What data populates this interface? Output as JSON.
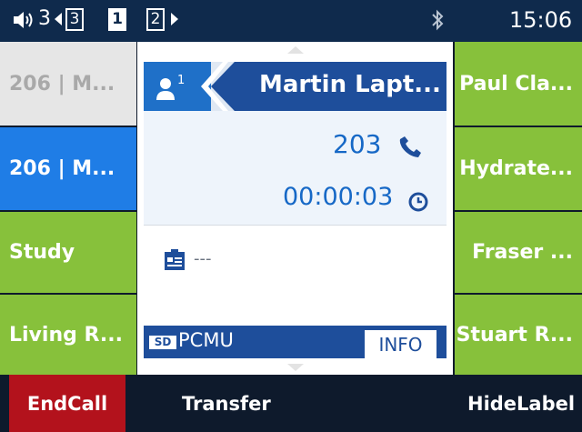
{
  "status_bar": {
    "line_number": "3",
    "pages": [
      "3",
      "1",
      "2"
    ],
    "active_page": "1",
    "time": "15:06"
  },
  "left_keys": [
    {
      "label": "206 | M..."
    },
    {
      "label": "206 | M..."
    },
    {
      "label": "Study"
    },
    {
      "label": "Living R..."
    }
  ],
  "right_keys": [
    {
      "label": "Paul Cla..."
    },
    {
      "label": "Hydrate..."
    },
    {
      "label": "Fraser ..."
    },
    {
      "label": "Stuart R..."
    }
  ],
  "call": {
    "contact_badge": "1",
    "name": "Martin Lapt...",
    "extension": "203",
    "duration": "00:00:03",
    "card_text": "---",
    "codec_badge": "SD",
    "codec": "PCMU",
    "info_label": "INFO"
  },
  "softkeys": {
    "end_call": "EndCall",
    "transfer": "Transfer",
    "hide_label": "HideLabel"
  },
  "colors": {
    "status_bar": "#0f2a4c",
    "key_green": "#87c13b",
    "key_blue": "#1f7de6",
    "key_white": "#e6e6e6",
    "header_blue": "#1e4e9b",
    "accent_text": "#1668c6",
    "end_call_red": "#b3121c"
  }
}
